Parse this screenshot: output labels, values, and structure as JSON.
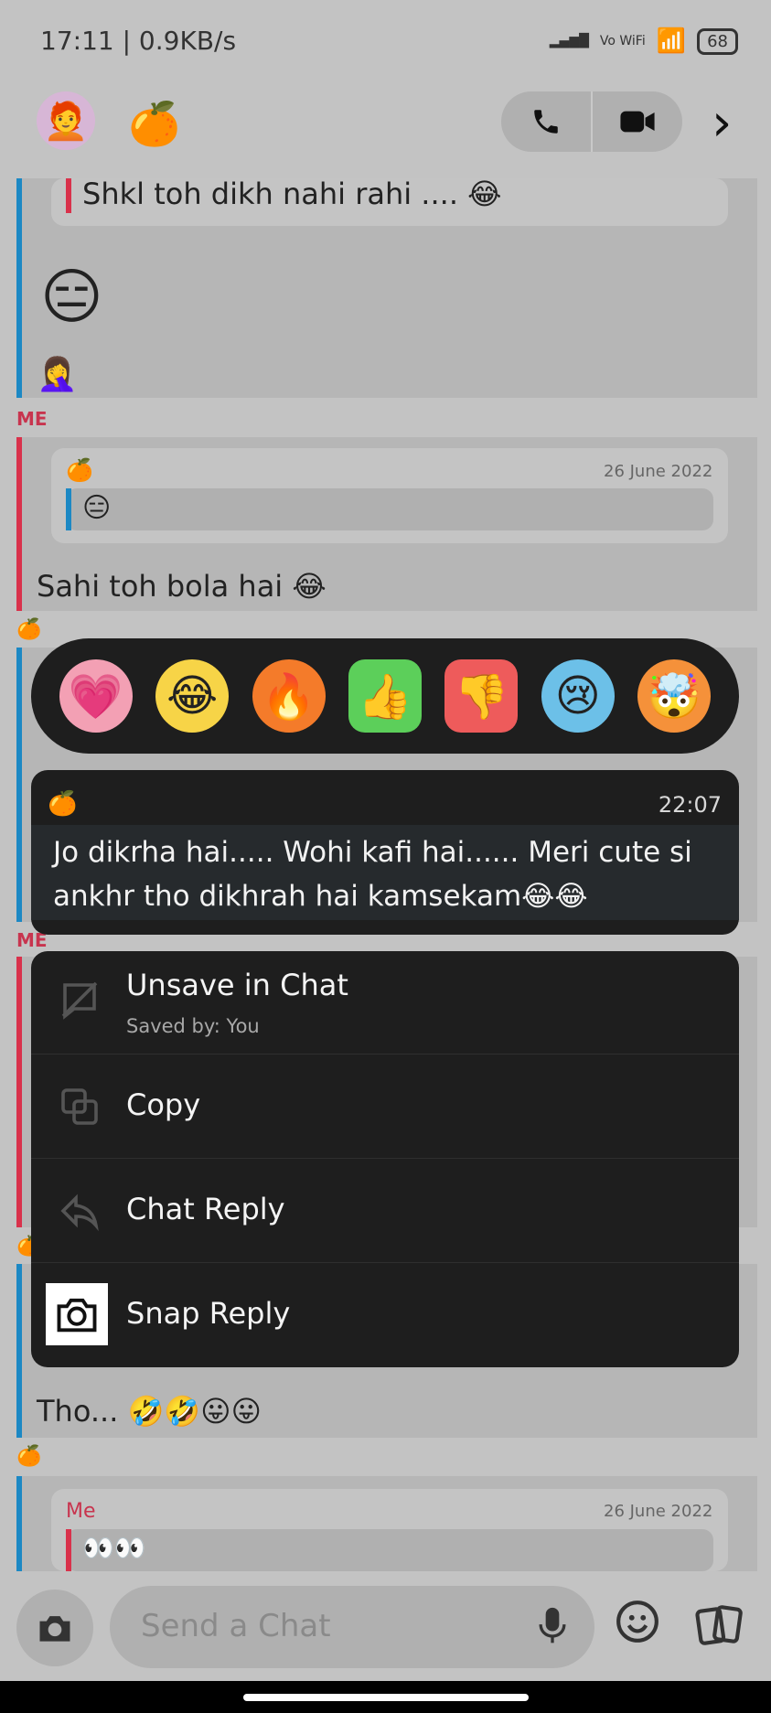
{
  "status_bar": {
    "time": "17:11 | 0.9KB/s",
    "network": "Vo WiFi",
    "battery": "68"
  },
  "header": {
    "avatar_icon": "bitmoji-avatar",
    "contact_emoji": "🍊",
    "call_icon": "phone-icon",
    "video_icon": "video-camera-icon",
    "next_icon": "chevron-right-icon"
  },
  "chat": {
    "msg1_text": "Shkl toh dikh nahi rahi .... 😂",
    "msg2_emoji": "😑",
    "msg3_emoji": "🤦‍♀️",
    "me_label_1": "ME",
    "quote1_sender": "🍊",
    "quote1_date": "26 June 2022",
    "quote1_text": "😑",
    "msg4_text": "Sahi toh bola hai 😂",
    "sender_emoji_1": "🍊",
    "me_label_2": "ME",
    "sender_emoji_2": "🍊",
    "msg5_text": "Tho... 🤣🤣😛😛",
    "sender_emoji_3": "🍊",
    "quote2_sender": "Me",
    "quote2_date": "26 June 2022",
    "quote2_text": "👀👀"
  },
  "reactions": [
    "💗",
    "😂",
    "🔥",
    "👍",
    "👎",
    "😢",
    "🤯"
  ],
  "focused_message": {
    "sender_emoji": "🍊",
    "time": "22:07",
    "text": "Jo dikrha hai..... Wohi  kafi hai...... Meri cute si ankhr tho dikhrah hai kamsekam😂😂"
  },
  "menu": {
    "unsave_label": "Unsave in Chat",
    "unsave_sub": "Saved by: You",
    "copy_label": "Copy",
    "chat_reply_label": "Chat Reply",
    "snap_reply_label": "Snap Reply"
  },
  "input": {
    "placeholder": "Send a Chat"
  }
}
